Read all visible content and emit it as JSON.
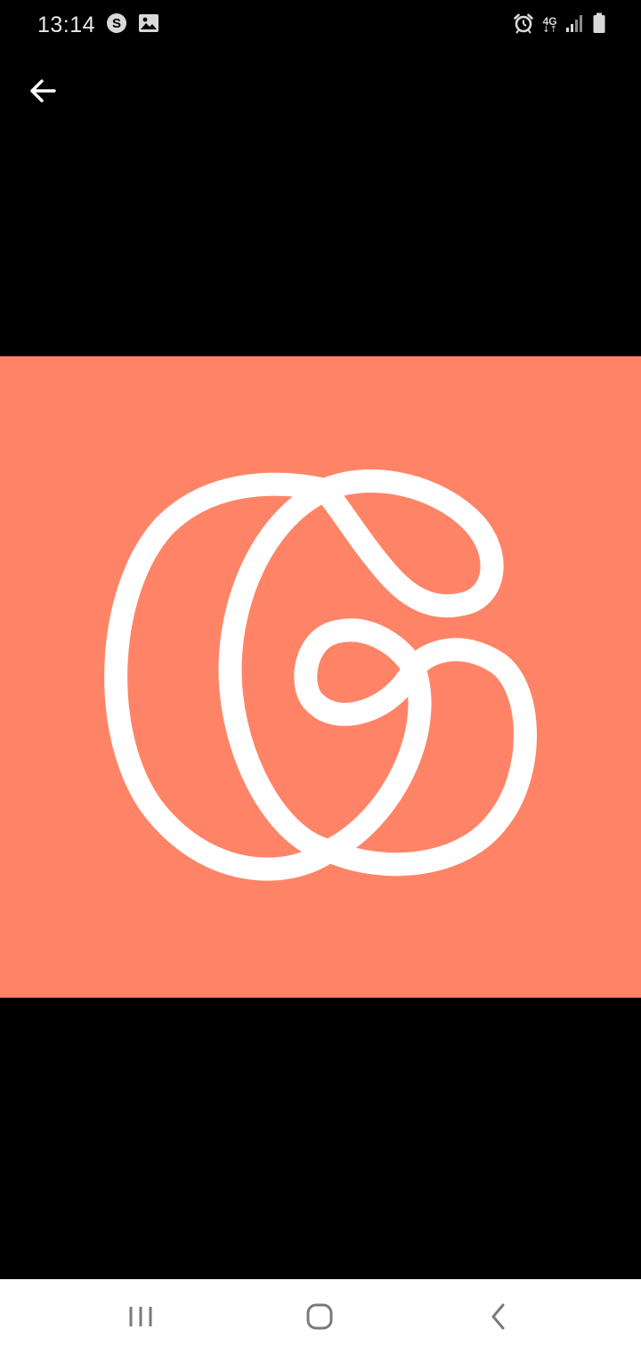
{
  "status_bar": {
    "time": "13:14",
    "network_type": "4G",
    "network_arrows": "↓↑",
    "left_icons": [
      "skype-notification-icon",
      "gallery-notification-icon"
    ],
    "right_icons": [
      "alarm-icon",
      "signal-icon",
      "battery-icon"
    ]
  },
  "app_bar": {
    "back_icon": "arrow-left-icon"
  },
  "image": {
    "background_color": "#FF8467",
    "logo_color": "#FFFFFF",
    "logo_name": "looped-g-logo"
  },
  "nav_bar": {
    "buttons": [
      "recent-apps",
      "home",
      "back"
    ]
  }
}
